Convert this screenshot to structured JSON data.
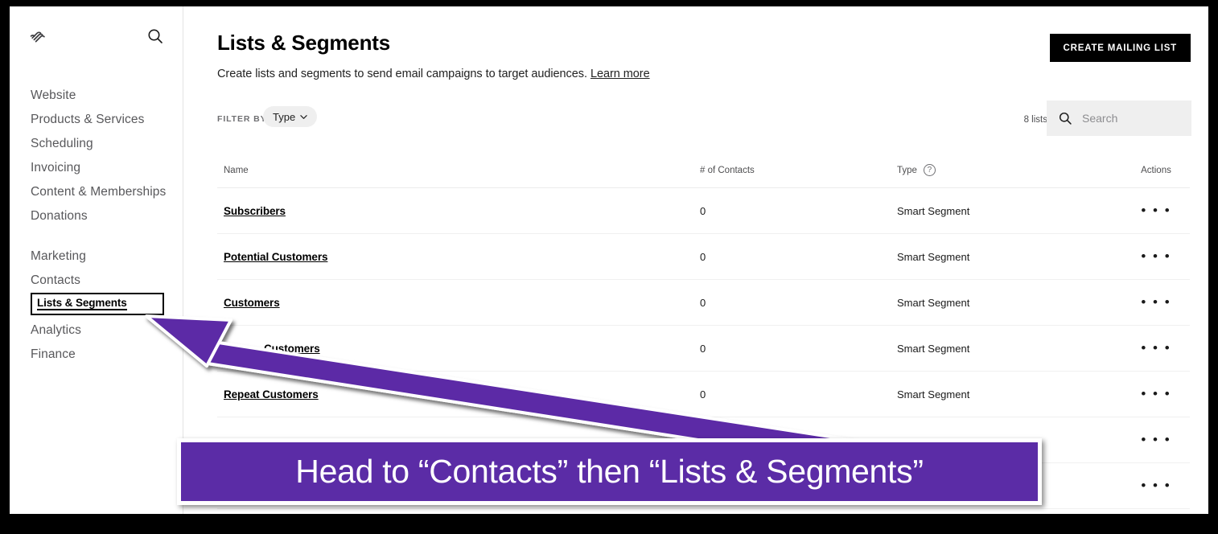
{
  "sidebar": {
    "logo_icon": "squarespace-logo-icon",
    "search_icon": "search-icon",
    "items": [
      {
        "label": "Website",
        "type": "nav"
      },
      {
        "label": "Products & Services",
        "type": "nav"
      },
      {
        "label": "Scheduling",
        "type": "nav"
      },
      {
        "label": "Invoicing",
        "type": "nav"
      },
      {
        "label": "Content & Memberships",
        "type": "nav"
      },
      {
        "label": "Donations",
        "type": "nav"
      },
      {
        "label": "Marketing",
        "type": "nav"
      },
      {
        "label": "Contacts",
        "type": "nav"
      },
      {
        "label": "Lists & Segments",
        "type": "highlighted"
      },
      {
        "label": "Analytics",
        "type": "nav"
      },
      {
        "label": "Finance",
        "type": "nav"
      }
    ]
  },
  "header": {
    "title": "Lists & Segments",
    "subtitle": "Create lists and segments to send email campaigns to target audiences.",
    "learn_more": "Learn more",
    "create_button": "CREATE MAILING LIST"
  },
  "toolbar": {
    "filter_by_label": "FILTER BY",
    "filter_pill": "Type",
    "chevron_icon": "chevron-down-icon",
    "lists_count": "8 lists",
    "search_icon": "search-icon",
    "search_placeholder": "Search",
    "search_value": ""
  },
  "table": {
    "columns": [
      "Name",
      "# of Contacts",
      "Type",
      "Actions"
    ],
    "type_help_icon": "question-mark-icon",
    "actions_icon": "ellipsis-icon",
    "rows": [
      {
        "name": "Subscribers",
        "contacts": "0",
        "type": "Smart Segment",
        "actions": "• • •"
      },
      {
        "name": "Potential Customers",
        "contacts": "0",
        "type": "Smart Segment",
        "actions": "• • •"
      },
      {
        "name": "Customers",
        "contacts": "0",
        "type": "Smart Segment",
        "actions": "• • •"
      },
      {
        "name": "Customers",
        "contacts": "0",
        "type": "Smart Segment",
        "actions": "• • •"
      },
      {
        "name": "Repeat Customers",
        "contacts": "0",
        "type": "Smart Segment",
        "actions": "• • •"
      },
      {
        "name": "",
        "contacts": "",
        "type": "",
        "actions": "• • •"
      },
      {
        "name": "",
        "contacts": "",
        "type": "",
        "actions": "• • •"
      }
    ]
  },
  "annotation": {
    "banner_text": "Head to “Contacts” then “Lists & Segments”",
    "arrow_icon": "arrow-pointer-icon",
    "accent_color": "#5b2ca6",
    "outline_color": "#ffffff"
  }
}
